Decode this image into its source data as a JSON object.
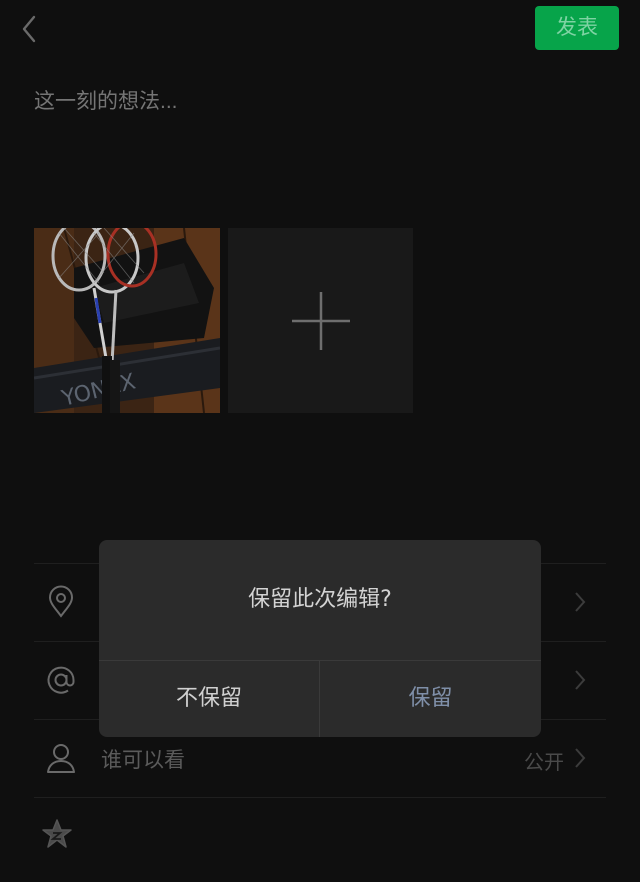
{
  "header": {
    "post_label": "发表",
    "back_icon": "chevron-left-icon"
  },
  "caption": {
    "placeholder": "这一刻的想法..."
  },
  "media": {
    "photo_subject": "badminton rackets on a bag",
    "add_icon": "plus-icon"
  },
  "list": {
    "location_icon": "location-pin-icon",
    "mention_icon": "at-icon",
    "visibility": {
      "icon": "person-icon",
      "label": "谁可以看",
      "value": "公开"
    },
    "star_icon": "star-icon"
  },
  "dialog": {
    "message": "保留此次编辑?",
    "discard_label": "不保留",
    "keep_label": "保留"
  },
  "colors": {
    "background": "#0f0f0f",
    "accent_green": "#07a44a",
    "dialog_bg": "#2b2b2b",
    "keep_text": "#7f8fa8"
  }
}
